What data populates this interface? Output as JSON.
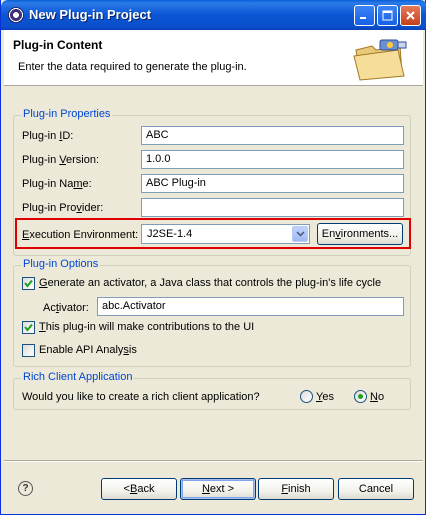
{
  "window": {
    "title": "New Plug-in Project"
  },
  "banner": {
    "title": "Plug-in Content",
    "description": "Enter the data required to generate the plug-in."
  },
  "properties": {
    "group_title": "Plug-in Properties",
    "id_label_pre": "Plug-in ",
    "id_label_key": "I",
    "id_label_post": "D:",
    "id_value": "ABC",
    "version_label_pre": "Plug-in ",
    "version_label_key": "V",
    "version_label_post": "ersion:",
    "version_value": "1.0.0",
    "name_label_pre": "Plug-in Na",
    "name_label_key": "m",
    "name_label_post": "e:",
    "name_value": "ABC Plug-in",
    "provider_label_pre": "Plug-in Pro",
    "provider_label_key": "v",
    "provider_label_post": "ider:",
    "provider_value": "",
    "env_label_key": "E",
    "env_label_post": "xecution Environment:",
    "env_value": "J2SE-1.4",
    "env_button_pre": "En",
    "env_button_key": "v",
    "env_button_post": "ironments..."
  },
  "options": {
    "group_title": "Plug-in Options",
    "activator_check_key": "G",
    "activator_check_post": "enerate an activator, a Java class that controls the plug-in's life cycle",
    "activator_checked": true,
    "activator_label_pre": "Ac",
    "activator_label_key": "t",
    "activator_label_post": "ivator:",
    "activator_value": "abc.Activator",
    "ui_check_key": "T",
    "ui_check_post": "his plug-in will make contributions to the UI",
    "ui_checked": true,
    "api_check_pre": "Enable API Analy",
    "api_check_key": "s",
    "api_check_post": "is",
    "api_checked": false
  },
  "rcp": {
    "group_title": "Rich Client Application",
    "question": "Would you like to create a rich client application?",
    "yes_key": "Y",
    "yes_post": "es",
    "no_key": "N",
    "no_post": "o",
    "selected": "No"
  },
  "buttons": {
    "back_pre": "< ",
    "back_key": "B",
    "back_post": "ack",
    "next_key": "N",
    "next_post": "ext >",
    "finish_key": "F",
    "finish_post": "inish",
    "cancel": "Cancel"
  },
  "colors": {
    "accent": "#0046d5",
    "highlight_border": "#e00000"
  }
}
